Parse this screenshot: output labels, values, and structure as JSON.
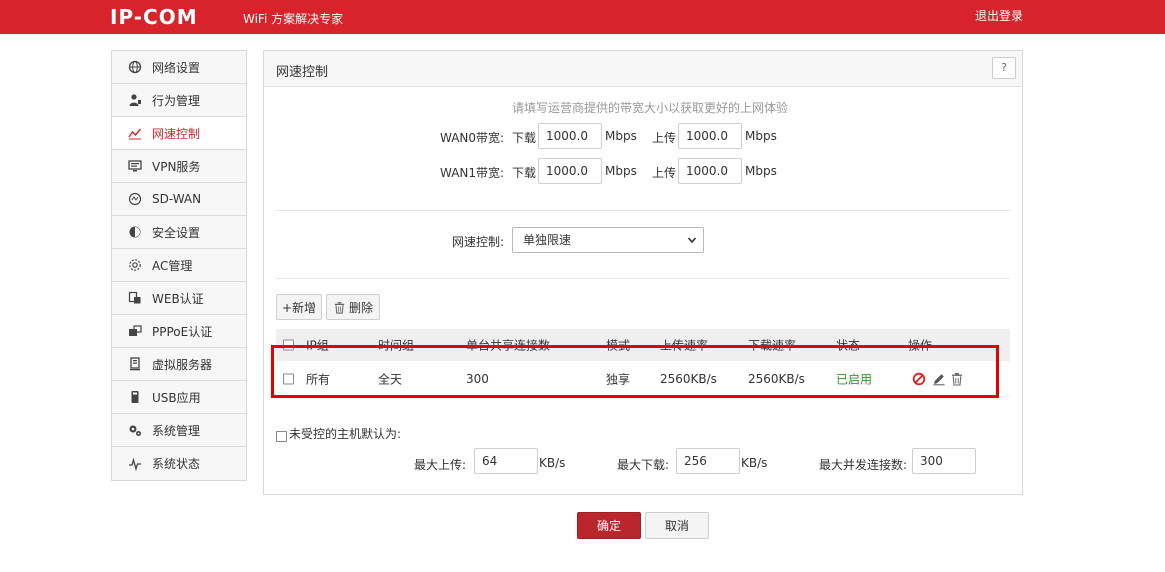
{
  "header": {
    "logo": "IP-COM",
    "slogan": "WiFi 方案解决专家",
    "logout_label": "退出登录"
  },
  "sidebar": {
    "items": [
      {
        "label": "网络设置",
        "icon": "globe-icon"
      },
      {
        "label": "行为管理",
        "icon": "user-icon"
      },
      {
        "label": "网速控制",
        "icon": "speed-line-icon",
        "active": true
      },
      {
        "label": "VPN服务",
        "icon": "monitor-icon"
      },
      {
        "label": "SD-WAN",
        "icon": "sdwan-icon"
      },
      {
        "label": "安全设置",
        "icon": "shield-icon"
      },
      {
        "label": "AC管理",
        "icon": "ac-icon"
      },
      {
        "label": "WEB认证",
        "icon": "web-auth-icon"
      },
      {
        "label": "PPPoE认证",
        "icon": "pppoe-icon"
      },
      {
        "label": "虚拟服务器",
        "icon": "server-icon"
      },
      {
        "label": "USB应用",
        "icon": "usb-icon"
      },
      {
        "label": "系统管理",
        "icon": "gear-icon"
      },
      {
        "label": "系统状态",
        "icon": "pulse-icon"
      }
    ]
  },
  "panel": {
    "title": "网速控制",
    "help_label": "?",
    "hint": "请填写运营商提供的带宽大小以获取更好的上网体验",
    "wan0": {
      "label": "WAN0带宽:",
      "down_label": "下载",
      "down_value": "1000.0",
      "down_unit": "Mbps",
      "up_label": "上传",
      "up_value": "1000.0",
      "up_unit": "Mbps"
    },
    "wan1": {
      "label": "WAN1带宽:",
      "down_label": "下载",
      "down_value": "1000.0",
      "down_unit": "Mbps",
      "up_label": "上传",
      "up_value": "1000.0",
      "up_unit": "Mbps"
    },
    "speed_control": {
      "label": "网速控制:",
      "selected": "单独限速"
    },
    "add_label": "+新增",
    "delete_label": "删除",
    "table": {
      "headers": [
        "IP组",
        "时间组",
        "单台共享连接数",
        "模式",
        "上传速率",
        "下载速率",
        "状态",
        "操作"
      ],
      "rows": [
        {
          "ip_group": "所有",
          "time_group": "全天",
          "connections": "300",
          "mode": "独享",
          "upload": "2560KB/s",
          "download": "2560KB/s",
          "status": "已启用"
        }
      ]
    },
    "uncontrolled": {
      "label": "未受控的主机默认为:",
      "max_up_label": "最大上传:",
      "max_up_value": "64",
      "max_up_unit": "KB/s",
      "max_down_label": "最大下载:",
      "max_down_value": "256",
      "max_down_unit": "KB/s",
      "max_conn_label": "最大并发连接数:",
      "max_conn_value": "300"
    }
  },
  "footer": {
    "confirm_label": "确定",
    "cancel_label": "取消"
  },
  "colors": {
    "brand": "#d8232c",
    "status_green": "#2a9d2a",
    "highlight": "#e30000"
  }
}
